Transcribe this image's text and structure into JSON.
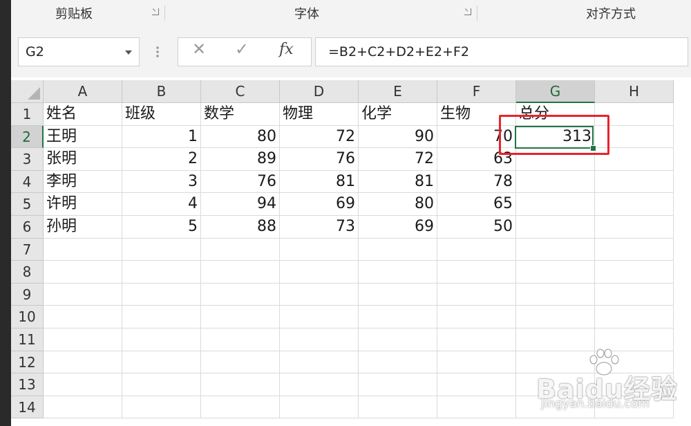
{
  "ribbon": {
    "groups": [
      {
        "label": "剪贴板"
      },
      {
        "label": "字体"
      },
      {
        "label": "对齐方式"
      }
    ]
  },
  "formula_bar": {
    "name_box": "G2",
    "cancel_icon": "✕",
    "enter_icon": "✓",
    "function_icon": "fx",
    "formula": "=B2+C2+D2+E2+F2"
  },
  "columns": [
    "A",
    "B",
    "C",
    "D",
    "E",
    "F",
    "G",
    "H"
  ],
  "selected_column": "G",
  "rows": [
    "1",
    "2",
    "3",
    "4",
    "5",
    "6",
    "7",
    "8",
    "9",
    "10",
    "11",
    "12",
    "13",
    "14"
  ],
  "selected_row": "2",
  "headers": [
    "姓名",
    "班级",
    "数学",
    "物理",
    "化学",
    "生物",
    "总分"
  ],
  "data_rows": [
    [
      "王明",
      "1",
      "80",
      "72",
      "90",
      "70",
      "313"
    ],
    [
      "张明",
      "2",
      "89",
      "76",
      "72",
      "63",
      ""
    ],
    [
      "李明",
      "3",
      "76",
      "81",
      "81",
      "78",
      ""
    ],
    [
      "许明",
      "4",
      "94",
      "69",
      "80",
      "65",
      ""
    ],
    [
      "孙明",
      "5",
      "88",
      "73",
      "69",
      "50",
      ""
    ]
  ],
  "watermark": {
    "logo": "Baidu经验",
    "url": "jingyan.baidu.com"
  },
  "colors": {
    "selection": "#217346",
    "highlight": "#e8232b"
  }
}
